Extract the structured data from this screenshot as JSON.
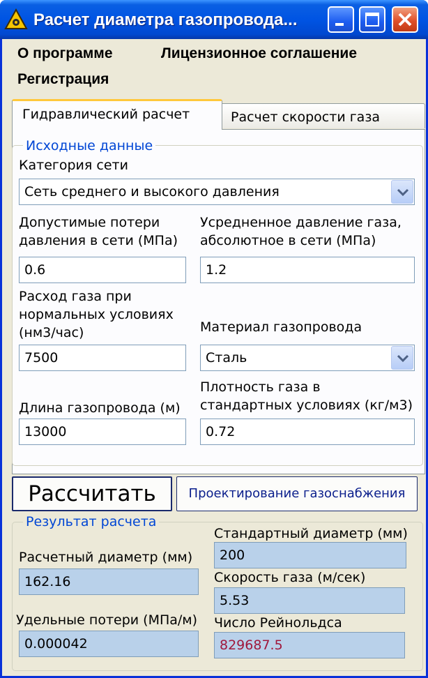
{
  "window": {
    "title": "Расчет диаметра газопровода..."
  },
  "menu": {
    "about": "О программе",
    "license": "Лицензионное соглашение",
    "registration": "Регистрация"
  },
  "tabs": {
    "hydraulic": "Гидравлический расчет",
    "speed": "Расчет скорости газа"
  },
  "input_group": {
    "legend": "Исходные данные",
    "network_category_label": "Категория сети",
    "network_category_value": "Сеть среднего и высокого давления",
    "allowed_loss_label_1": "Допустимые потери",
    "allowed_loss_label_2": "давления в сети (МПа)",
    "allowed_loss_value": "0.6",
    "avg_pressure_label_1": "Усредненное давление газа,",
    "avg_pressure_label_2": "абсолютное в сети (МПа)",
    "avg_pressure_value": "1.2",
    "flow_label_1": "Расход газа при",
    "flow_label_2": "нормальных условиях",
    "flow_label_3": "(нм3/час)",
    "flow_value": "7500",
    "material_label": "Материал газопровода",
    "material_value": "Сталь",
    "length_label": "Длина газопровода (м)",
    "length_value": "13000",
    "density_label_1": "Плотность газа в",
    "density_label_2": "стандартных условиях (кг/м3)",
    "density_value": "0.72"
  },
  "buttons": {
    "calculate": "Рассчитать",
    "design": "Проектирование газоснабжения"
  },
  "result_group": {
    "legend": "Результат расчета",
    "std_diameter_label": "Стандартный диаметр (мм)",
    "std_diameter_value": "200",
    "calc_diameter_label": "Расчетный диаметр (мм)",
    "calc_diameter_value": "162.16",
    "gas_speed_label": "Скорость газа (м/сек)",
    "gas_speed_value": "5.53",
    "specific_loss_label": "Удельные потери (МПа/м)",
    "specific_loss_value": "0.000042",
    "reynolds_label": "Число Рейнольдса",
    "reynolds_value": "829687.5"
  },
  "colors": {
    "titlebar": "#0054e3",
    "accent": "#0046d5",
    "result_field": "#b9d1ea",
    "reynolds_text": "#a0183c"
  }
}
